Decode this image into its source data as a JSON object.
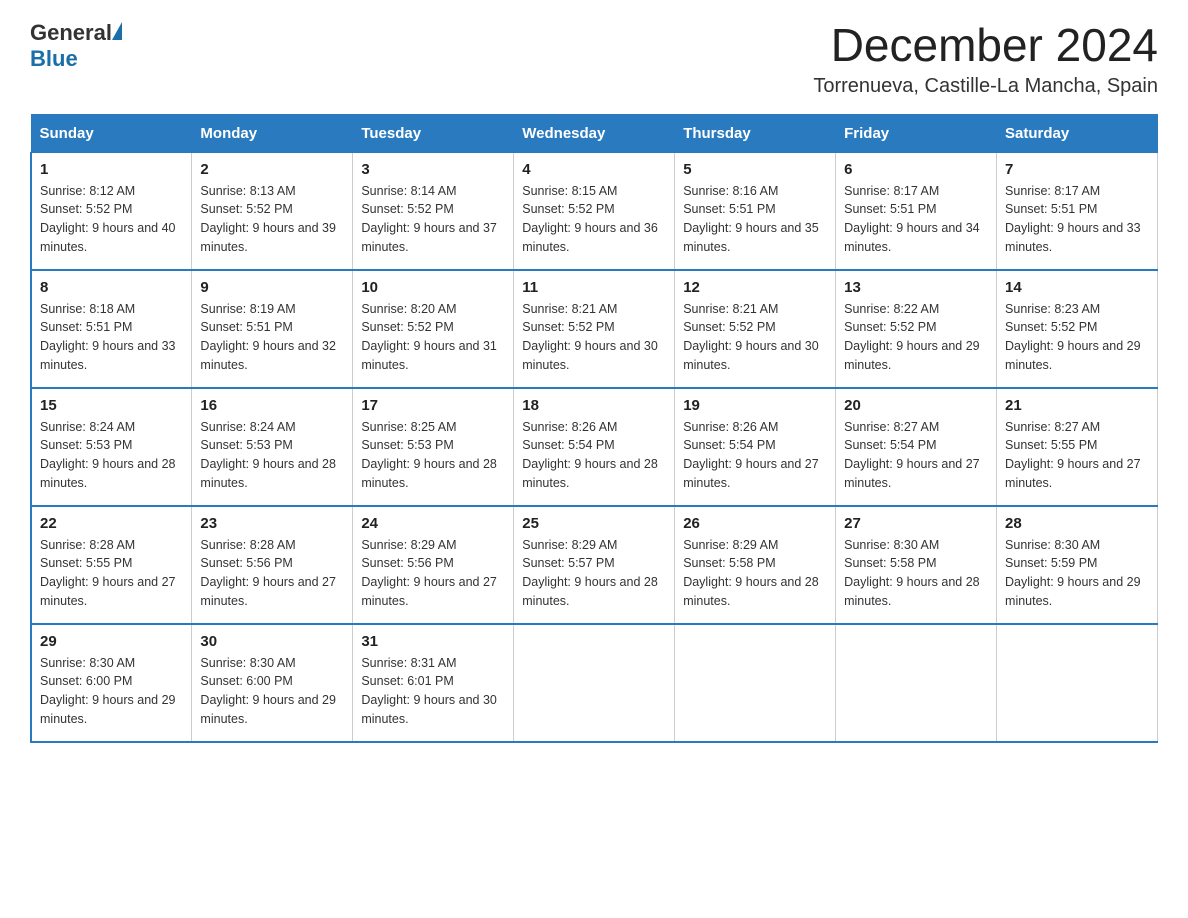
{
  "header": {
    "logo": {
      "text_general": "General",
      "text_blue": "Blue"
    },
    "title": "December 2024",
    "location": "Torrenueva, Castille-La Mancha, Spain"
  },
  "days_of_week": [
    "Sunday",
    "Monday",
    "Tuesday",
    "Wednesday",
    "Thursday",
    "Friday",
    "Saturday"
  ],
  "weeks": [
    [
      {
        "day": "1",
        "sunrise": "8:12 AM",
        "sunset": "5:52 PM",
        "daylight": "9 hours and 40 minutes."
      },
      {
        "day": "2",
        "sunrise": "8:13 AM",
        "sunset": "5:52 PM",
        "daylight": "9 hours and 39 minutes."
      },
      {
        "day": "3",
        "sunrise": "8:14 AM",
        "sunset": "5:52 PM",
        "daylight": "9 hours and 37 minutes."
      },
      {
        "day": "4",
        "sunrise": "8:15 AM",
        "sunset": "5:52 PM",
        "daylight": "9 hours and 36 minutes."
      },
      {
        "day": "5",
        "sunrise": "8:16 AM",
        "sunset": "5:51 PM",
        "daylight": "9 hours and 35 minutes."
      },
      {
        "day": "6",
        "sunrise": "8:17 AM",
        "sunset": "5:51 PM",
        "daylight": "9 hours and 34 minutes."
      },
      {
        "day": "7",
        "sunrise": "8:17 AM",
        "sunset": "5:51 PM",
        "daylight": "9 hours and 33 minutes."
      }
    ],
    [
      {
        "day": "8",
        "sunrise": "8:18 AM",
        "sunset": "5:51 PM",
        "daylight": "9 hours and 33 minutes."
      },
      {
        "day": "9",
        "sunrise": "8:19 AM",
        "sunset": "5:51 PM",
        "daylight": "9 hours and 32 minutes."
      },
      {
        "day": "10",
        "sunrise": "8:20 AM",
        "sunset": "5:52 PM",
        "daylight": "9 hours and 31 minutes."
      },
      {
        "day": "11",
        "sunrise": "8:21 AM",
        "sunset": "5:52 PM",
        "daylight": "9 hours and 30 minutes."
      },
      {
        "day": "12",
        "sunrise": "8:21 AM",
        "sunset": "5:52 PM",
        "daylight": "9 hours and 30 minutes."
      },
      {
        "day": "13",
        "sunrise": "8:22 AM",
        "sunset": "5:52 PM",
        "daylight": "9 hours and 29 minutes."
      },
      {
        "day": "14",
        "sunrise": "8:23 AM",
        "sunset": "5:52 PM",
        "daylight": "9 hours and 29 minutes."
      }
    ],
    [
      {
        "day": "15",
        "sunrise": "8:24 AM",
        "sunset": "5:53 PM",
        "daylight": "9 hours and 28 minutes."
      },
      {
        "day": "16",
        "sunrise": "8:24 AM",
        "sunset": "5:53 PM",
        "daylight": "9 hours and 28 minutes."
      },
      {
        "day": "17",
        "sunrise": "8:25 AM",
        "sunset": "5:53 PM",
        "daylight": "9 hours and 28 minutes."
      },
      {
        "day": "18",
        "sunrise": "8:26 AM",
        "sunset": "5:54 PM",
        "daylight": "9 hours and 28 minutes."
      },
      {
        "day": "19",
        "sunrise": "8:26 AM",
        "sunset": "5:54 PM",
        "daylight": "9 hours and 27 minutes."
      },
      {
        "day": "20",
        "sunrise": "8:27 AM",
        "sunset": "5:54 PM",
        "daylight": "9 hours and 27 minutes."
      },
      {
        "day": "21",
        "sunrise": "8:27 AM",
        "sunset": "5:55 PM",
        "daylight": "9 hours and 27 minutes."
      }
    ],
    [
      {
        "day": "22",
        "sunrise": "8:28 AM",
        "sunset": "5:55 PM",
        "daylight": "9 hours and 27 minutes."
      },
      {
        "day": "23",
        "sunrise": "8:28 AM",
        "sunset": "5:56 PM",
        "daylight": "9 hours and 27 minutes."
      },
      {
        "day": "24",
        "sunrise": "8:29 AM",
        "sunset": "5:56 PM",
        "daylight": "9 hours and 27 minutes."
      },
      {
        "day": "25",
        "sunrise": "8:29 AM",
        "sunset": "5:57 PM",
        "daylight": "9 hours and 28 minutes."
      },
      {
        "day": "26",
        "sunrise": "8:29 AM",
        "sunset": "5:58 PM",
        "daylight": "9 hours and 28 minutes."
      },
      {
        "day": "27",
        "sunrise": "8:30 AM",
        "sunset": "5:58 PM",
        "daylight": "9 hours and 28 minutes."
      },
      {
        "day": "28",
        "sunrise": "8:30 AM",
        "sunset": "5:59 PM",
        "daylight": "9 hours and 29 minutes."
      }
    ],
    [
      {
        "day": "29",
        "sunrise": "8:30 AM",
        "sunset": "6:00 PM",
        "daylight": "9 hours and 29 minutes."
      },
      {
        "day": "30",
        "sunrise": "8:30 AM",
        "sunset": "6:00 PM",
        "daylight": "9 hours and 29 minutes."
      },
      {
        "day": "31",
        "sunrise": "8:31 AM",
        "sunset": "6:01 PM",
        "daylight": "9 hours and 30 minutes."
      },
      null,
      null,
      null,
      null
    ]
  ]
}
